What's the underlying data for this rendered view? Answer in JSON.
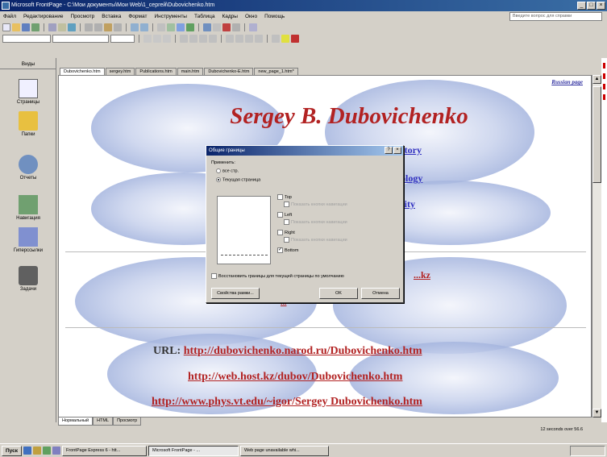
{
  "window": {
    "title": "Microsoft FrontPage - C:\\Мои документы\\Мои Web\\1_сергей\\Dubovichenko.htm",
    "controls": [
      "_",
      "□",
      "×"
    ]
  },
  "menu": [
    "Файл",
    "Редактирование",
    "Просмотр",
    "Вставка",
    "Формат",
    "Инструменты",
    "Таблица",
    "Кадры",
    "Окно",
    "Помощь"
  ],
  "help_placeholder": "Введите вопрос для справки",
  "views_bar": {
    "title": "Виды",
    "items": [
      {
        "label": "Страницы",
        "icon": "page-view-icon"
      },
      {
        "label": "Папки",
        "icon": "folders-view-icon"
      },
      {
        "label": "Отчеты",
        "icon": "reports-view-icon"
      },
      {
        "label": "Навигация",
        "icon": "navigation-view-icon"
      },
      {
        "label": "Гиперссылки",
        "icon": "hyperlinks-view-icon"
      },
      {
        "label": "Задачи",
        "icon": "tasks-view-icon"
      }
    ]
  },
  "file_tabs": [
    {
      "label": "Dubovichenko.htm",
      "active": true
    },
    {
      "label": "sergey.htm",
      "active": false
    },
    {
      "label": "Publications.htm",
      "active": false
    },
    {
      "label": "main.htm",
      "active": false
    },
    {
      "label": "Dubovichenko-E.htm",
      "active": false
    },
    {
      "label": "new_page_1.htm*",
      "active": false
    }
  ],
  "page": {
    "russian_link": "Russian page",
    "title": "Sergey B. Dubovichenko",
    "links_right": [
      "...story",
      "...ology",
      "...sity"
    ],
    "link_k": "...kz",
    "link_mid": "...",
    "url_label": "URL:",
    "urls": [
      "http://dubovichenko.narod.ru/Dubovichenko.htm",
      "http://web.host.kz/dubov/Dubovichenko.htm",
      "http://www.phys.vt.edu/~igor/Sergey Dubovichenko.htm"
    ]
  },
  "dialog": {
    "title": "Общие границы",
    "apply_label": "Применить:",
    "radio_all": "все стр.",
    "radio_selected": "Текущая страница",
    "options": [
      {
        "label": "Top",
        "checked": false,
        "sub": "Показать кнопки навигации"
      },
      {
        "label": "Left",
        "checked": false,
        "sub": "Показать кнопки навигации"
      },
      {
        "label": "Right",
        "checked": false,
        "sub": "Показать кнопки навигации"
      },
      {
        "label": "Bottom",
        "checked": true,
        "sub": ""
      }
    ],
    "reset_checkbox": "Восстановить границы для текущей страницы по умолчанию",
    "btn_advanced": "Свойства рамки...",
    "btn_ok": "OK",
    "btn_cancel": "Отмена"
  },
  "view_tabs": [
    {
      "label": "Нормальный",
      "active": true
    },
    {
      "label": "HTML",
      "active": false
    },
    {
      "label": "Просмотр",
      "active": false
    }
  ],
  "status": {
    "right": "12 seconds over 56.6"
  },
  "taskbar": {
    "start": "Пуск",
    "tasks": [
      {
        "label": "FrontPage Express 6 - htt...",
        "active": false
      },
      {
        "label": "Microsoft FrontPage - ...",
        "active": true
      },
      {
        "label": "Web page unavailable whi...",
        "active": false
      }
    ]
  },
  "colors": {
    "title_red": "#b22222",
    "link_blue": "#3030c0",
    "titlebar": "#0a246a"
  }
}
